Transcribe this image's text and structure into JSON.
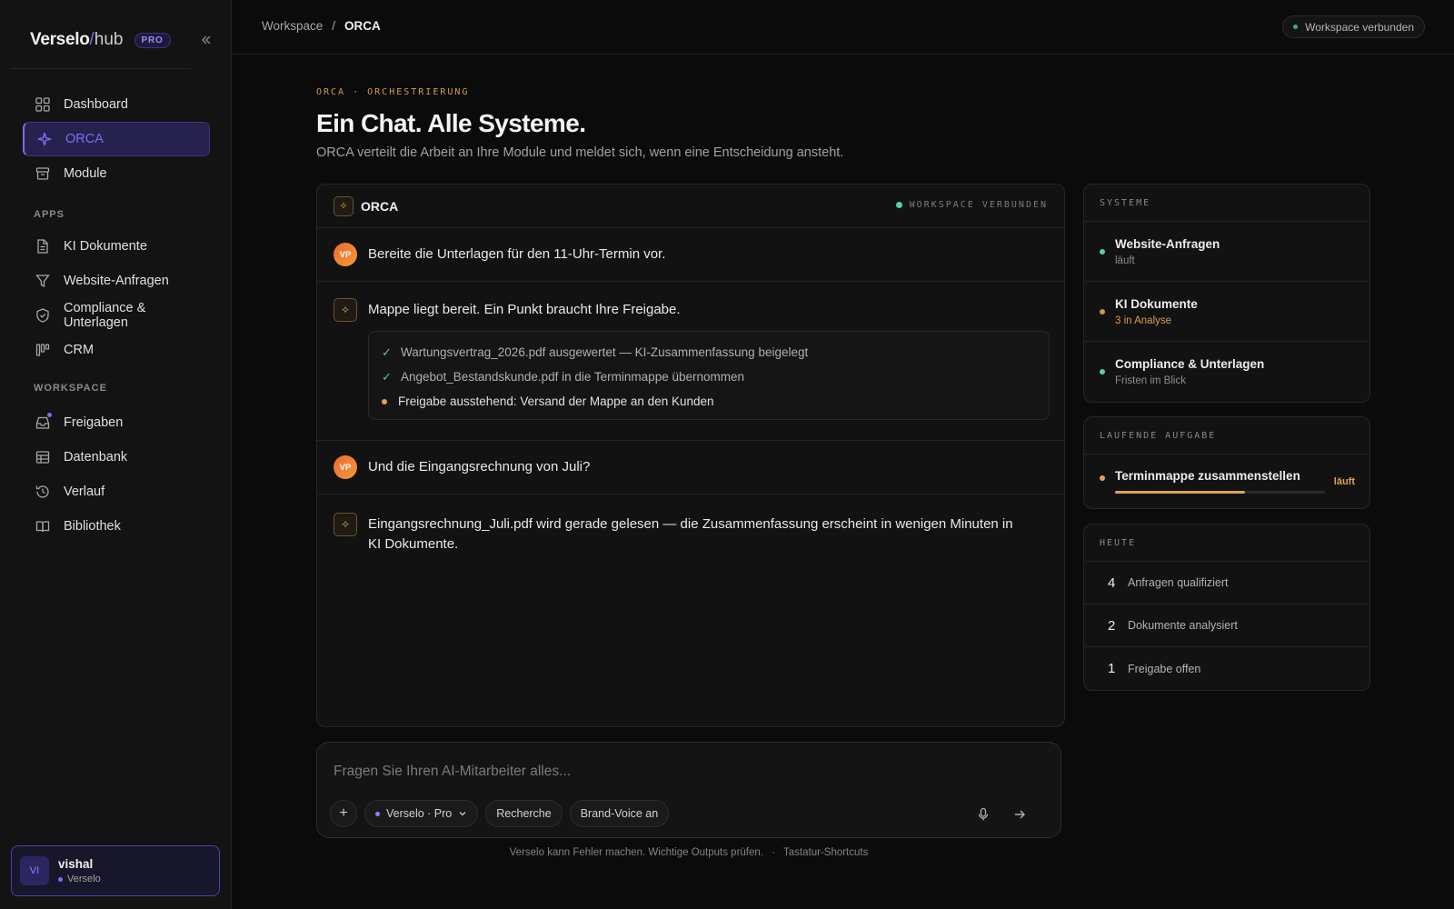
{
  "brand": {
    "name": "Verselo",
    "slash": "/",
    "suffix": "hub",
    "badge": "PRO"
  },
  "sidebar": {
    "main": [
      {
        "label": "Dashboard",
        "icon": "grid-icon"
      },
      {
        "label": "ORCA",
        "icon": "sparkle-icon",
        "active": true
      },
      {
        "label": "Module",
        "icon": "stack-icon"
      }
    ],
    "apps_title": "APPS",
    "apps": [
      {
        "label": "KI Dokumente",
        "icon": "document-icon"
      },
      {
        "label": "Website-Anfragen",
        "icon": "filter-icon"
      },
      {
        "label": "Compliance & Unterlagen",
        "icon": "shield-icon"
      },
      {
        "label": "CRM",
        "icon": "kanban-icon"
      }
    ],
    "workspace_title": "WORKSPACE",
    "workspace": [
      {
        "label": "Freigaben",
        "icon": "inbox-icon",
        "notification": true
      },
      {
        "label": "Datenbank",
        "icon": "table-icon"
      },
      {
        "label": "Verlauf",
        "icon": "history-icon"
      },
      {
        "label": "Bibliothek",
        "icon": "book-icon"
      }
    ],
    "user": {
      "initials": "VI",
      "name": "vishal",
      "org": "Verselo"
    }
  },
  "topbar": {
    "breadcrumb": [
      "Workspace",
      "ORCA"
    ],
    "breadcrumb_sep": "/",
    "connection": "Workspace verbunden"
  },
  "hero": {
    "eyebrow": "ORCA · ORCHESTRIERUNG",
    "title": "Ein Chat. Alle Systeme.",
    "subtitle": "ORCA verteilt die Arbeit an Ihre Module und meldet sich, wenn eine Entscheidung ansteht."
  },
  "chat": {
    "title": "ORCA",
    "status": "WORKSPACE VERBUNDEN",
    "user_initials": "VP",
    "messages": [
      {
        "from": "user",
        "text": "Bereite die Unterlagen für den 11-Uhr-Termin vor."
      },
      {
        "from": "orca",
        "text": "Mappe liegt bereit. Ein Punkt braucht Ihre Freigabe."
      },
      {
        "from": "user",
        "text": "Und die Eingangsrechnung von Juli?"
      },
      {
        "from": "orca",
        "text": "Eingangsrechnung_Juli.pdf wird gerade gelesen — die Zusammenfassung erscheint in wenigen Minuten in KI Dokumente."
      }
    ],
    "checklist": [
      {
        "state": "done",
        "text": "Wartungsvertrag_2026.pdf ausgewertet — KI-Zusammenfassung beigelegt"
      },
      {
        "state": "done",
        "text": "Angebot_Bestandskunde.pdf in die Terminmappe übernommen"
      },
      {
        "state": "pending",
        "text": "Freigabe ausstehend: Versand der Mappe an den Kunden"
      }
    ]
  },
  "composer": {
    "placeholder": "Fragen Sie Ihren AI-Mitarbeiter alles...",
    "model": "Verselo · Pro",
    "chips": [
      "Recherche",
      "Brand-Voice an"
    ],
    "footer": "Verselo kann Fehler machen. Wichtige Outputs prüfen.",
    "footer_sep": "·",
    "shortcuts": "Tastatur-Shortcuts"
  },
  "systems": {
    "title": "SYSTEME",
    "items": [
      {
        "title": "Website-Anfragen",
        "sub": "läuft",
        "status_color": "#4fd6a0"
      },
      {
        "title": "KI Dokumente",
        "sub": "3 in Analyse",
        "status_color": "#c9954f"
      },
      {
        "title": "Compliance & Unterlagen",
        "sub": "Fristen im Blick",
        "status_color": "#4fd6a0"
      }
    ]
  },
  "task": {
    "title": "LAUFENDE AUFGABE",
    "name": "Terminmappe zusammenstellen",
    "state": "läuft",
    "progress": 0.62
  },
  "today": {
    "title": "HEUTE",
    "items": [
      {
        "count": "4",
        "label": "Anfragen qualifiziert"
      },
      {
        "count": "2",
        "label": "Dokumente analysiert"
      },
      {
        "count": "1",
        "label": "Freigabe offen"
      }
    ]
  },
  "colors": {
    "accent": "#7b6cf6",
    "orca": "#e2a860",
    "success": "#4fd6a0",
    "warning": "#e0a24d"
  }
}
